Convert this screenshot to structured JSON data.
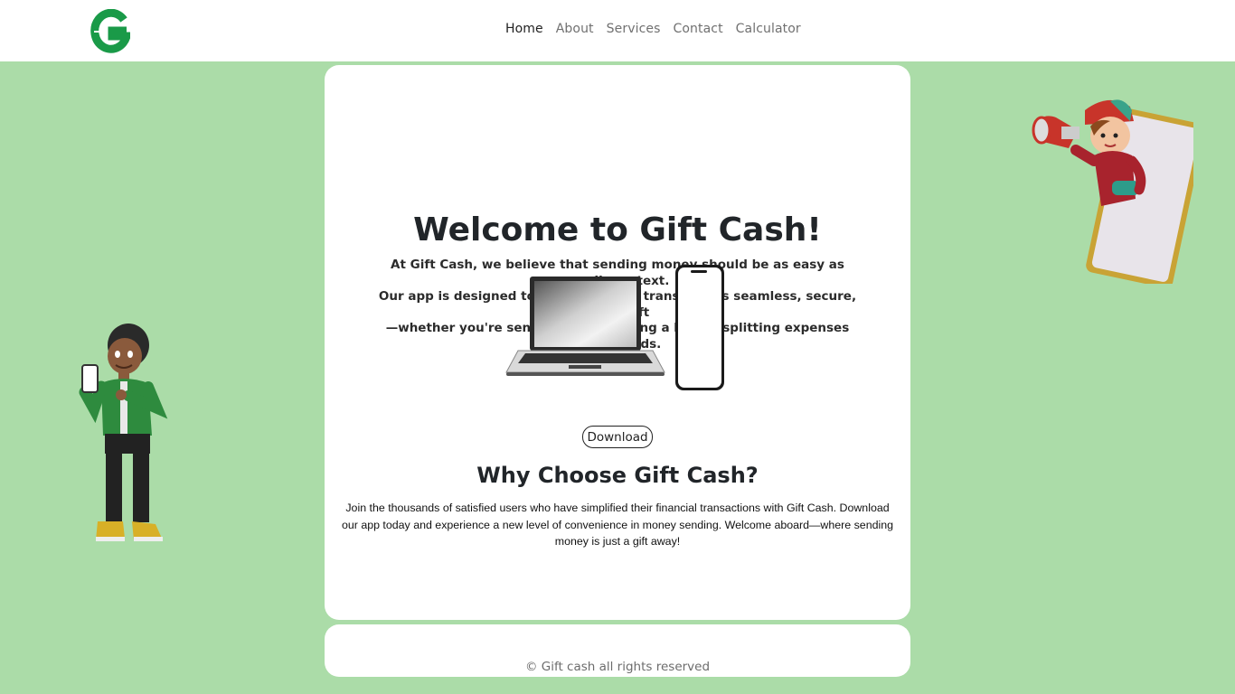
{
  "nav": {
    "brand_logo": "logo-icon",
    "items": [
      {
        "label": "Home",
        "active": true
      },
      {
        "label": "About",
        "active": false
      },
      {
        "label": "Services",
        "active": false
      },
      {
        "label": "Contact",
        "active": false
      },
      {
        "label": "Calculator",
        "active": false
      }
    ]
  },
  "hero": {
    "title": "Welcome to Gift Cash!",
    "intro_lines": [
      "At Gift Cash, we believe that sending money should be as easy as sending a text.",
      "Our app is designed to make financial transactions seamless, secure, and swift",
      "—whether you're sending a gift, paying a bill, or splitting expenses with friends."
    ],
    "download_label": "Download"
  },
  "why": {
    "title": "Why Choose Gift Cash?",
    "text": "Join the thousands of satisfied users who have simplified their financial transactions with Gift Cash. Download our app today and experience a new level of convenience in money sending. Welcome aboard—where sending money is just a gift away!"
  },
  "footer": {
    "text": "© Gift cash all rights reserved"
  },
  "colors": {
    "page_background": "#abdca8",
    "brand_green": "#1a9a48",
    "card_background": "#ffffff"
  },
  "illustrations": [
    "laptop-phone-illustration",
    "man-with-phone-illustration",
    "boy-with-megaphone-illustration"
  ]
}
